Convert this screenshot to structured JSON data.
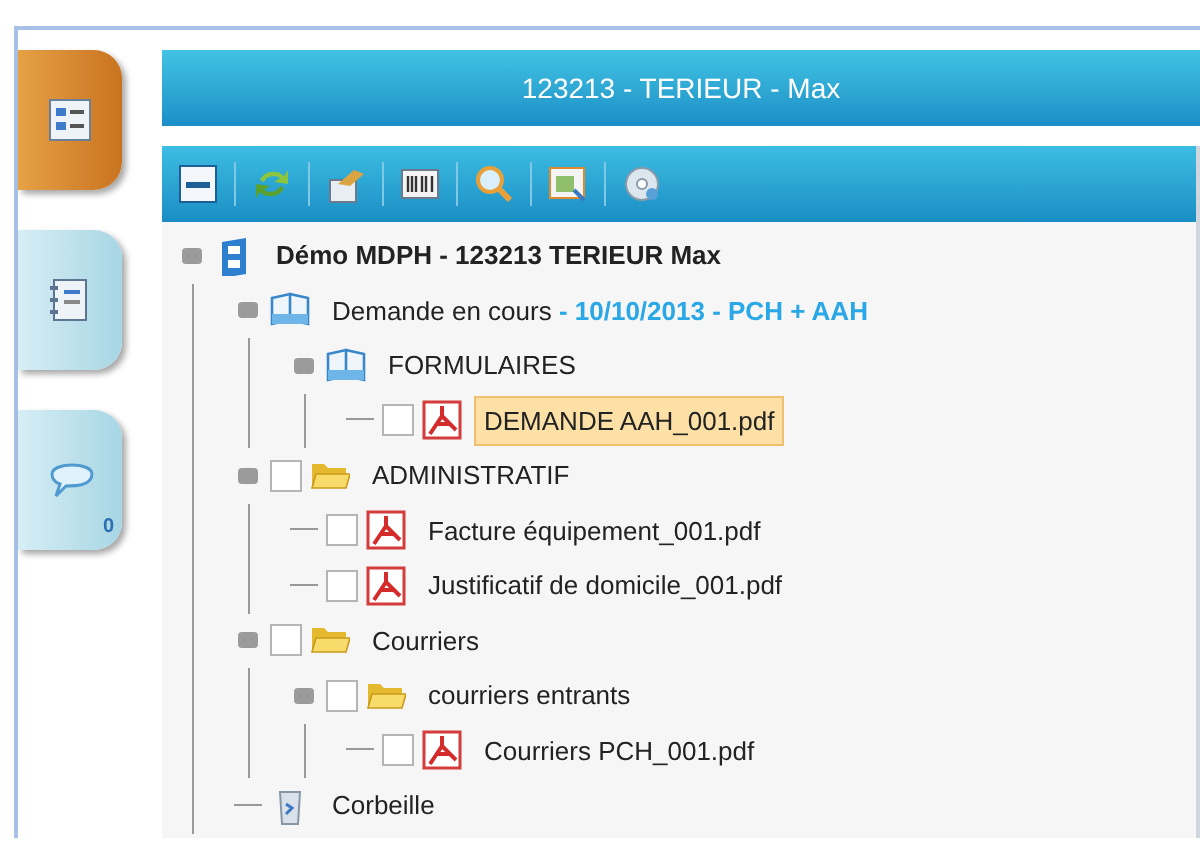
{
  "side_tabs": [
    {
      "kind": "tree",
      "selected": true
    },
    {
      "kind": "notebook",
      "selected": false
    },
    {
      "kind": "comments",
      "selected": false,
      "badge": "0"
    }
  ],
  "header": {
    "title": "123213 - TERIEUR - Max"
  },
  "toolbar": [
    {
      "kind": "collapse"
    },
    {
      "kind": "refresh"
    },
    {
      "kind": "export"
    },
    {
      "kind": "barcode"
    },
    {
      "kind": "search"
    },
    {
      "kind": "view"
    },
    {
      "kind": "disc"
    }
  ],
  "tree": [
    {
      "label": "Démo MDPH - 123213 TERIEUR Max",
      "kind": "root",
      "expanded": true,
      "selected": false,
      "children": [
        {
          "label": "Demande en cours",
          "suffix": " - 10/10/2013 - PCH + AAH",
          "kind": "book",
          "expanded": true,
          "selected": false,
          "children": [
            {
              "label": "FORMULAIRES",
              "kind": "book",
              "expanded": true,
              "selected": false,
              "children": [
                {
                  "label": "DEMANDE AAH_001.pdf",
                  "kind": "pdf",
                  "checked": false,
                  "selected": true
                }
              ]
            }
          ]
        },
        {
          "label": "ADMINISTRATIF",
          "kind": "folder",
          "expanded": true,
          "checked": false,
          "selected": false,
          "children": [
            {
              "label": "Facture équipement_001.pdf",
              "kind": "pdf",
              "checked": false,
              "selected": false
            },
            {
              "label": "Justificatif de domicile_001.pdf",
              "kind": "pdf",
              "checked": false,
              "selected": false
            }
          ]
        },
        {
          "label": "Courriers",
          "kind": "folder",
          "expanded": true,
          "checked": false,
          "selected": false,
          "children": [
            {
              "label": "courriers entrants",
              "kind": "folder",
              "expanded": true,
              "checked": false,
              "selected": false,
              "children": [
                {
                  "label": "Courriers PCH_001.pdf",
                  "kind": "pdf",
                  "checked": false,
                  "selected": false
                }
              ]
            }
          ]
        },
        {
          "label": "Corbeille",
          "kind": "trash",
          "selected": false
        }
      ]
    }
  ]
}
